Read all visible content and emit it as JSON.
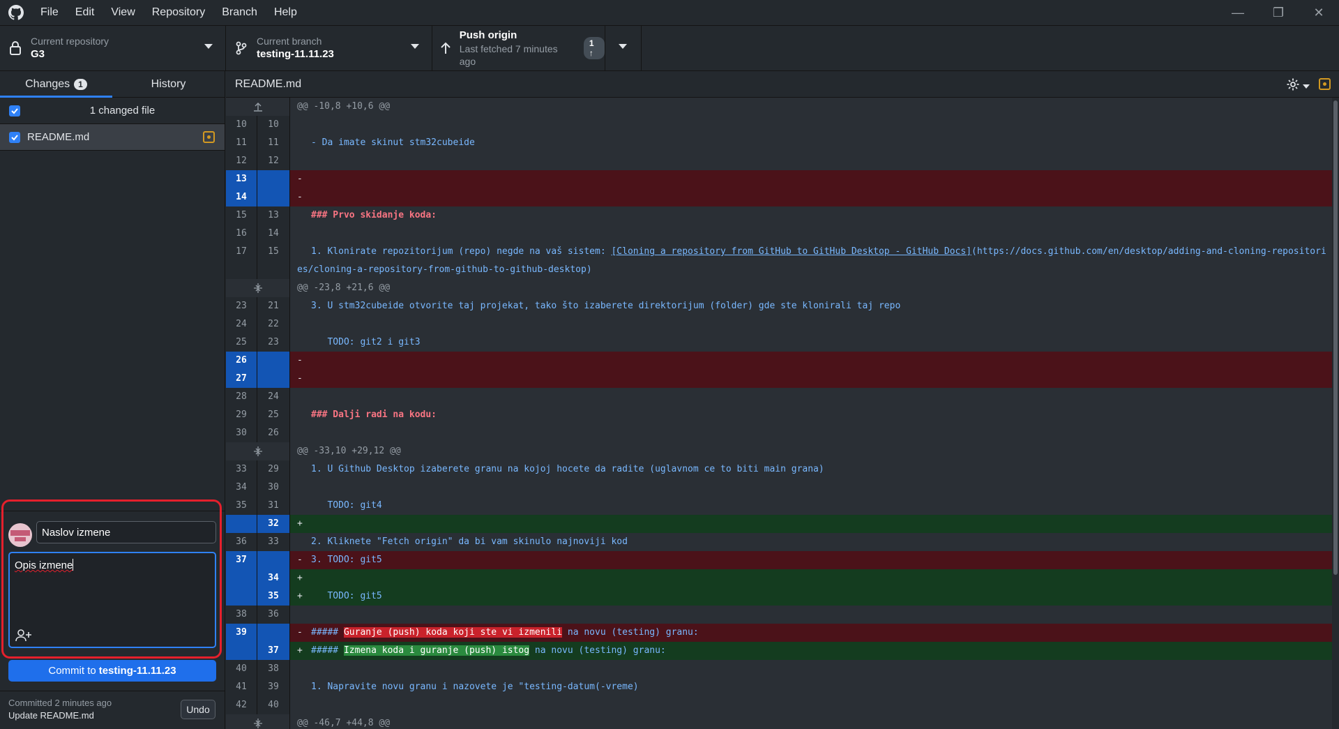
{
  "menu": [
    "File",
    "Edit",
    "View",
    "Repository",
    "Branch",
    "Help"
  ],
  "toolbar": {
    "repo_label": "Current repository",
    "repo_value": "G3",
    "branch_label": "Current branch",
    "branch_value": "testing-11.11.23",
    "push_label": "Push origin",
    "push_sub": "Last fetched 7 minutes ago",
    "push_badge": "1 ↑"
  },
  "sidebar": {
    "tab_changes": "Changes",
    "tab_changes_count": "1",
    "tab_history": "History",
    "changed_header": "1 changed file",
    "file_name": "README.md"
  },
  "commit": {
    "summary_value": "Naslov izmene",
    "description_value": "Opis izmene",
    "button_prefix": "Commit to",
    "button_branch": "testing-11.11.23",
    "last_commit_time": "Committed 2 minutes ago",
    "last_commit_msg": "Update README.md",
    "undo": "Undo"
  },
  "diff": {
    "file": "README.md",
    "lines": [
      {
        "t": "hunk",
        "text": "@@ -10,8 +10,6 @@",
        "icon": "expand-up"
      },
      {
        "t": "ctx",
        "o": "10",
        "n": "10",
        "text": ""
      },
      {
        "t": "ctx",
        "o": "11",
        "n": "11",
        "text": "- Da imate skinut stm32cubeide"
      },
      {
        "t": "ctx",
        "o": "12",
        "n": "12",
        "text": ""
      },
      {
        "t": "del",
        "o": "13",
        "n": "",
        "text": ""
      },
      {
        "t": "del",
        "o": "14",
        "n": "",
        "text": ""
      },
      {
        "t": "ctx",
        "o": "15",
        "n": "13",
        "text": "### Prvo skidanje koda:",
        "h": true
      },
      {
        "t": "ctx",
        "o": "16",
        "n": "14",
        "text": ""
      },
      {
        "t": "wrap",
        "o": "17",
        "n": "15",
        "pre": "1. Klonirate repozitorijum (repo) negde na vaš sistem: ",
        "link": "[Cloning a repository from GitHub to GitHub Desktop - GitHub Docs]",
        "post": "(https://docs.github.com/en/desktop/adding-and-cloning-repositories/cloning-a-repository-from-github-to-github-desktop)"
      },
      {
        "t": "hunk",
        "text": "@@ -23,8 +21,6 @@",
        "icon": "expand"
      },
      {
        "t": "ctx",
        "o": "23",
        "n": "21",
        "text": "3. U stm32cubeide otvorite taj projekat, tako što izaberete direktorijum (folder) gde ste klonirali taj repo"
      },
      {
        "t": "ctx",
        "o": "24",
        "n": "22",
        "text": ""
      },
      {
        "t": "ctx",
        "o": "25",
        "n": "23",
        "text": "   TODO: git2 i git3"
      },
      {
        "t": "del",
        "o": "26",
        "n": "",
        "text": ""
      },
      {
        "t": "del",
        "o": "27",
        "n": "",
        "text": ""
      },
      {
        "t": "ctx",
        "o": "28",
        "n": "24",
        "text": ""
      },
      {
        "t": "ctx",
        "o": "29",
        "n": "25",
        "text": "### Dalji radi na kodu:",
        "h": true
      },
      {
        "t": "ctx",
        "o": "30",
        "n": "26",
        "text": ""
      },
      {
        "t": "hunk",
        "text": "@@ -33,10 +29,12 @@",
        "icon": "expand"
      },
      {
        "t": "ctx",
        "o": "33",
        "n": "29",
        "text": "1. U Github Desktop izaberete granu na kojoj hocete da radite (uglavnom ce to biti main grana)"
      },
      {
        "t": "ctx",
        "o": "34",
        "n": "30",
        "text": ""
      },
      {
        "t": "ctx",
        "o": "35",
        "n": "31",
        "text": "   TODO: git4"
      },
      {
        "t": "add",
        "o": "",
        "n": "32",
        "text": ""
      },
      {
        "t": "ctx",
        "o": "36",
        "n": "33",
        "text": "2. Kliknete \"Fetch origin\" da bi vam skinulo najnoviji kod"
      },
      {
        "t": "del",
        "o": "37",
        "n": "",
        "text": "3. TODO: git5"
      },
      {
        "t": "add",
        "o": "",
        "n": "34",
        "text": ""
      },
      {
        "t": "add",
        "o": "",
        "n": "35",
        "text": "   TODO: git5"
      },
      {
        "t": "ctx",
        "o": "38",
        "n": "36",
        "text": ""
      },
      {
        "t": "delhl",
        "o": "39",
        "n": "",
        "pre": "##### ",
        "hl": "Guranje (push) koda koji ste vi izmenili",
        "post": " na novu (testing) granu:"
      },
      {
        "t": "addhl",
        "o": "",
        "n": "37",
        "pre": "##### ",
        "hl": "Izmena koda i guranje (push) istog",
        "post": " na novu (testing) granu:"
      },
      {
        "t": "ctx",
        "o": "40",
        "n": "38",
        "text": ""
      },
      {
        "t": "ctx",
        "o": "41",
        "n": "39",
        "text": "1. Napravite novu granu i nazovete je \"testing-datum(-vreme)"
      },
      {
        "t": "ctx",
        "o": "42",
        "n": "40",
        "text": ""
      },
      {
        "t": "hunk",
        "text": "@@ -46,7 +44,8 @@",
        "icon": "expand"
      }
    ]
  }
}
